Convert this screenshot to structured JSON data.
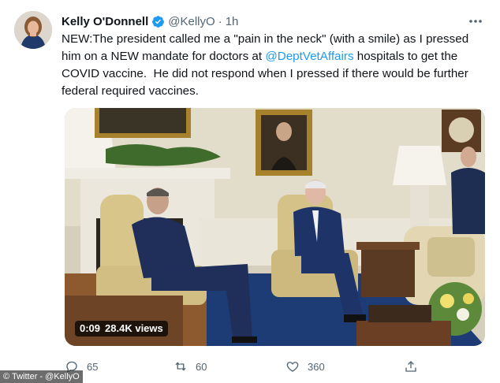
{
  "tweet": {
    "author_name": "Kelly O'Donnell",
    "handle": "@KellyO",
    "separator": "·",
    "time": "1h",
    "text_part1": "NEW:The president called me a \"pain in the neck\" (with a smile) as I pressed him on a NEW mandate for doctors at ",
    "mention": "@DeptVetAffairs",
    "text_part2": " hospitals to get the COVID vaccine.  He did not respond when I pressed if there would be further federal required vaccines."
  },
  "video": {
    "duration": "0:09",
    "views": "28.4K views"
  },
  "actions": {
    "replies": "65",
    "retweets": "60",
    "likes": "360"
  },
  "credit": "© Twitter - @KellyO",
  "icons": [
    "verified-icon",
    "more-icon",
    "reply-icon",
    "retweet-icon",
    "like-icon",
    "share-icon"
  ],
  "colors": {
    "accent": "#1d9bf0",
    "text": "#0f1419",
    "secondary": "#536471"
  }
}
